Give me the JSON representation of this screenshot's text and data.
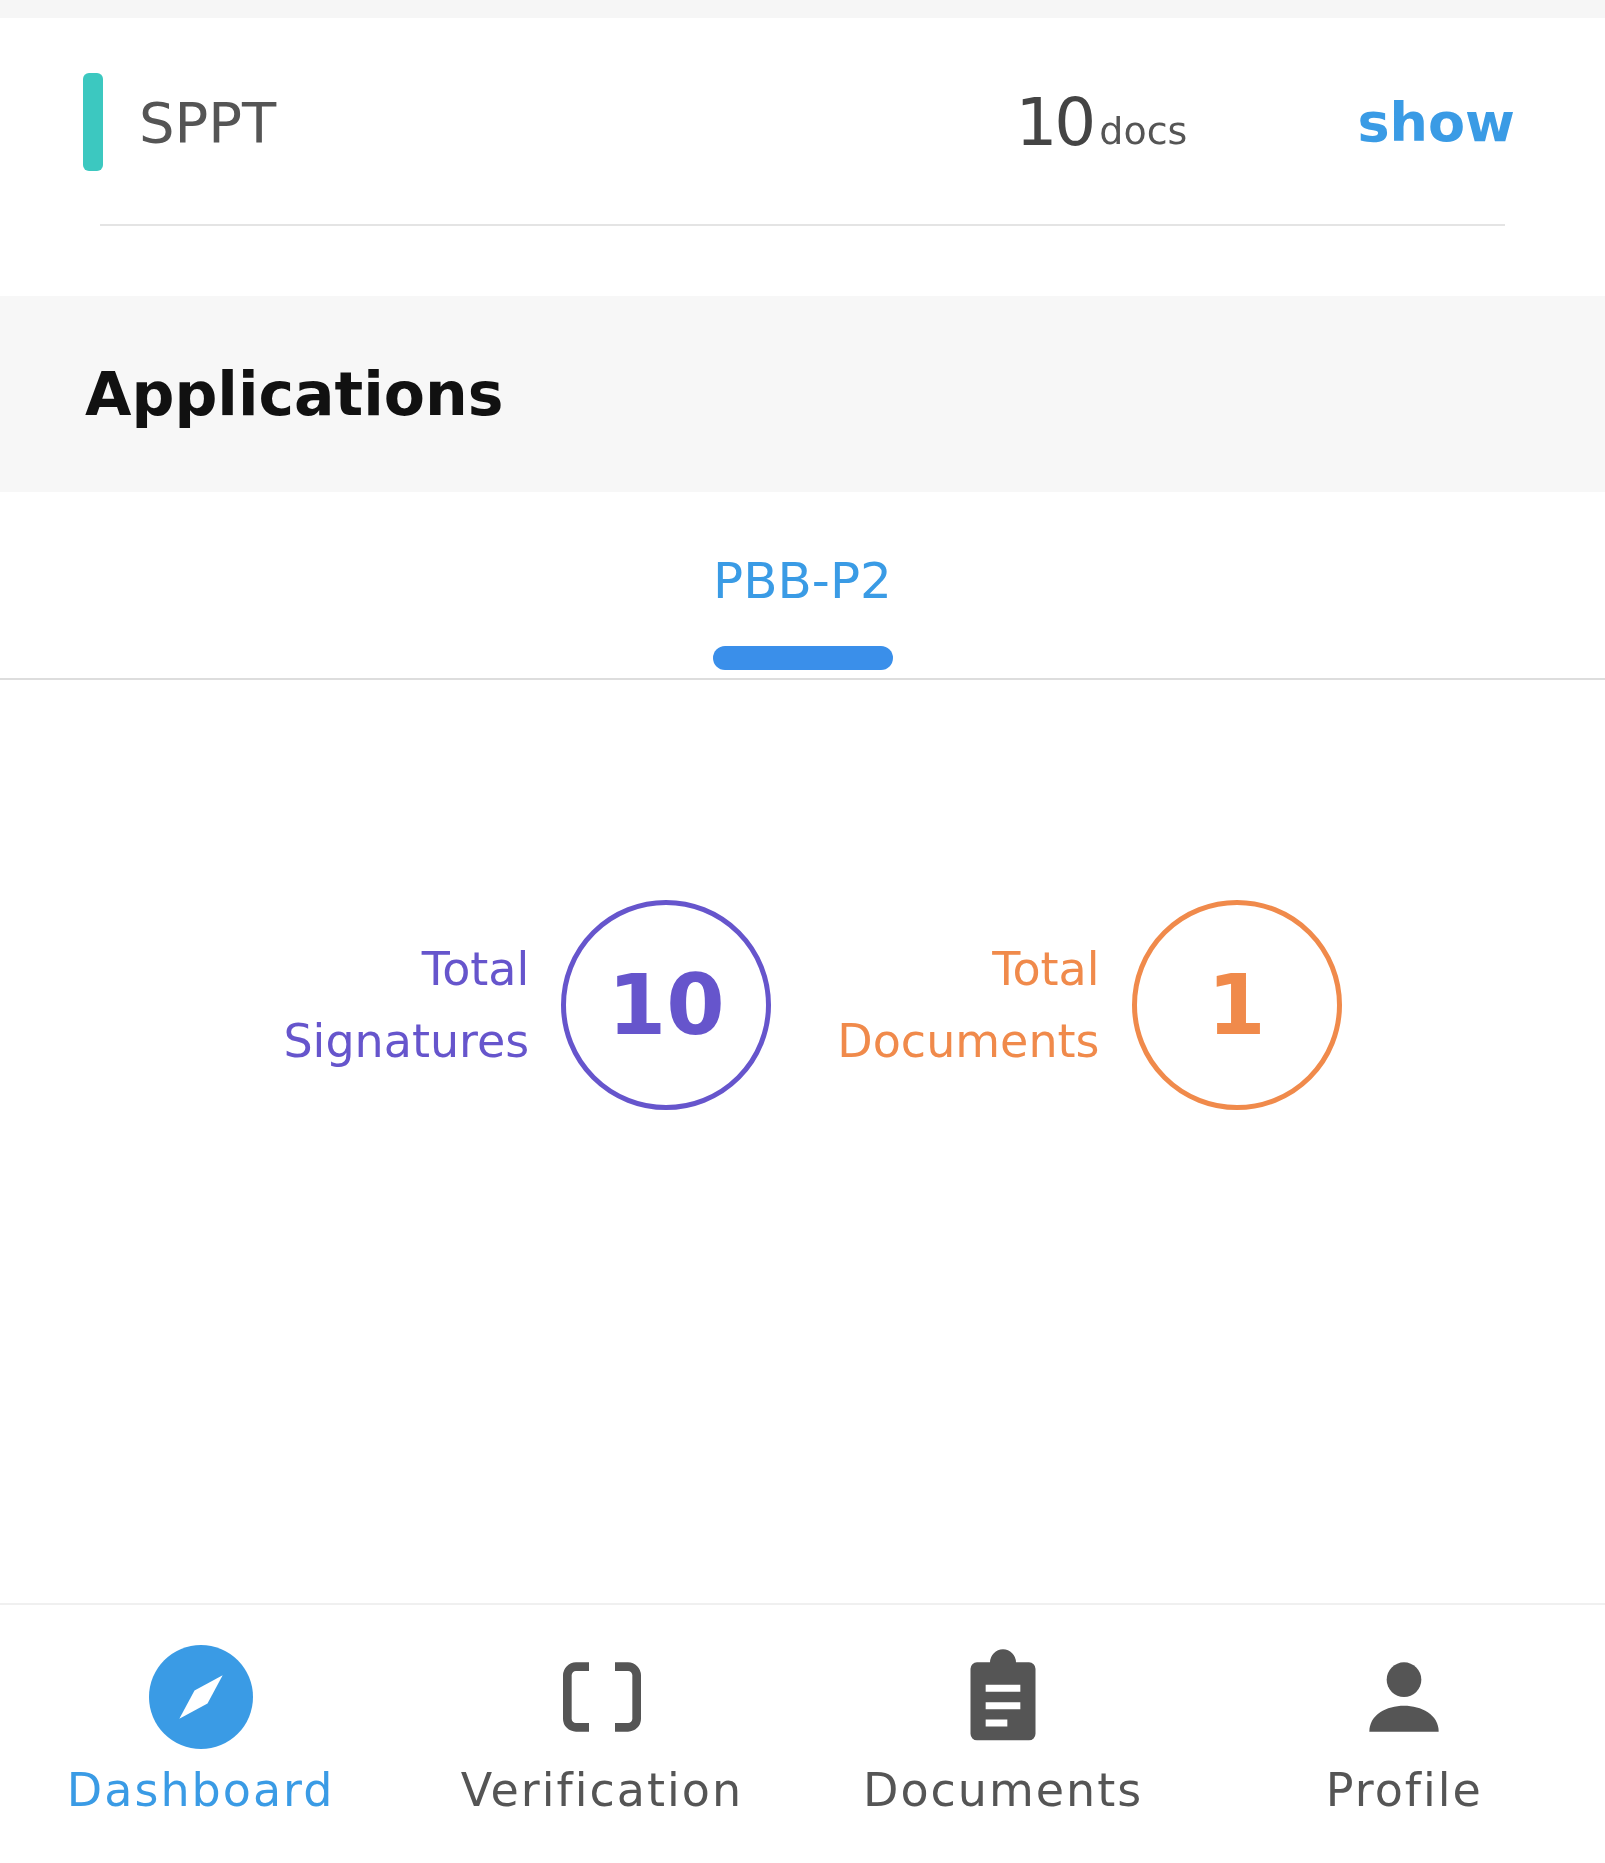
{
  "summary_row": {
    "label": "SPPT",
    "count": "10",
    "unit": "docs",
    "action": "show",
    "color": "#3cc8c0"
  },
  "section": {
    "title": "Applications"
  },
  "tabs": [
    {
      "label": "PBB-P2",
      "selected": true
    }
  ],
  "stats": [
    {
      "label_line1": "Total",
      "label_line2": "Signatures",
      "value": "10",
      "color": "#6655cc"
    },
    {
      "label_line1": "Total",
      "label_line2": "Documents",
      "value": "1",
      "color": "#f08a4b"
    }
  ],
  "bottom_nav": [
    {
      "kind": "dashboard",
      "label": "Dashboard",
      "selected": true
    },
    {
      "kind": "verification",
      "label": "Verification",
      "selected": false
    },
    {
      "kind": "documents",
      "label": "Documents",
      "selected": false
    },
    {
      "kind": "profile",
      "label": "Profile",
      "selected": false
    }
  ]
}
